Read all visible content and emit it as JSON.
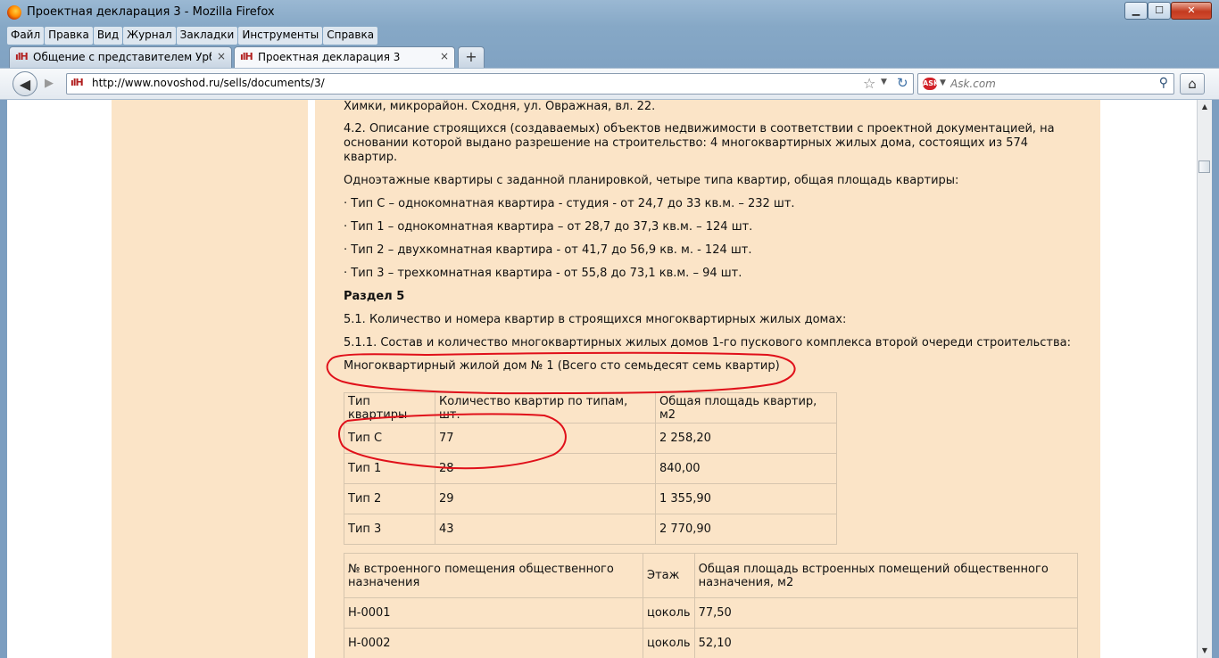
{
  "window": {
    "title": "Проектная декларация 3 - Mozilla Firefox",
    "minimize_glyph": "▁",
    "maximize_glyph": "☐",
    "close_glyph": "✕",
    "app_icon": "firefox-icon"
  },
  "menubar": {
    "items": [
      "Файл",
      "Правка",
      "Вид",
      "Журнал",
      "Закладки",
      "Инструменты",
      "Справка"
    ]
  },
  "tabs": [
    {
      "label": "Общение с представителем Урбан-...",
      "icon": "site-favicon",
      "close": "×",
      "active": false
    },
    {
      "label": "Проектная декларация 3",
      "icon": "site-favicon",
      "close": "×",
      "active": true
    }
  ],
  "newtab_glyph": "+",
  "nav": {
    "url": "http://www.novoshod.ru/sells/documents/3/",
    "favicon_text": "ılH",
    "back_glyph": "◀",
    "forward_glyph": "▶",
    "star_glyph": "☆",
    "dropdown_glyph": "▼",
    "reload_glyph": "↻",
    "search_engine_icon": "ask-icon",
    "search_engine_badge": "ASK",
    "search_placeholder": "Ask.com",
    "search_glyph": "⚲",
    "home_glyph": "⌂"
  },
  "content": {
    "address_line": "Химки, микрорайон. Сходня, ул. Овражная, вл. 22.",
    "p_4_2": "4.2. Описание строящихся (создаваемых) объектов недвижимости в соответствии с проектной документацией, на основании которой выдано разрешение на строительство: 4 многоквартирных жилых дома, состоящих из 574 квартир.",
    "p_single_floor": "Одноэтажные квартиры с заданной планировкой, четыре типа квартир, общая площадь квартиры:",
    "bullets": [
      "· Тип С – однокомнатная квартира - студия - от 24,7 до 33 кв.м. – 232 шт.",
      "· Тип 1 – однокомнатная квартира – от 28,7 до 37,3 кв.м. – 124 шт.",
      "· Тип 2 – двухкомнатная квартира - от 41,7 до 56,9 кв. м. - 124 шт.",
      "· Тип 3 – трехкомнатная квартира - от 55,8 до 73,1 кв.м. – 94 шт."
    ],
    "section_title": "Раздел 5",
    "p_5_1": "5.1. Количество и номера квартир в строящихся многоквартирных жилых домах:",
    "p_5_1_1": "5.1.1. Состав и количество многоквартирных жилых домов 1-го пускового комплекса второй очереди строительства:",
    "house_line": "Многоквартирный жилой дом № 1 (Всего сто семьдесят семь квартир)",
    "table1": {
      "headers": [
        "Тип квартиры",
        "Количество квартир по типам, шт.",
        "Общая площадь квартир, м2"
      ],
      "rows": [
        [
          "Тип С",
          "77",
          "2 258,20"
        ],
        [
          "Тип 1",
          "28",
          "840,00"
        ],
        [
          "Тип 2",
          "29",
          "1 355,90"
        ],
        [
          "Тип 3",
          "43",
          "2 770,90"
        ]
      ]
    },
    "table2": {
      "headers": [
        "№ встроенного помещения общественного назначения",
        "Этаж",
        "Общая площадь встроенных помещений общественного назначения, м2"
      ],
      "rows": [
        [
          "Н-0001",
          "цоколь",
          "77,50"
        ],
        [
          "Н-0002",
          "цоколь",
          "52,10"
        ]
      ]
    }
  },
  "scrollbar": {
    "up_glyph": "▲",
    "down_glyph": "▼"
  },
  "annotation_color": "#e0101a"
}
